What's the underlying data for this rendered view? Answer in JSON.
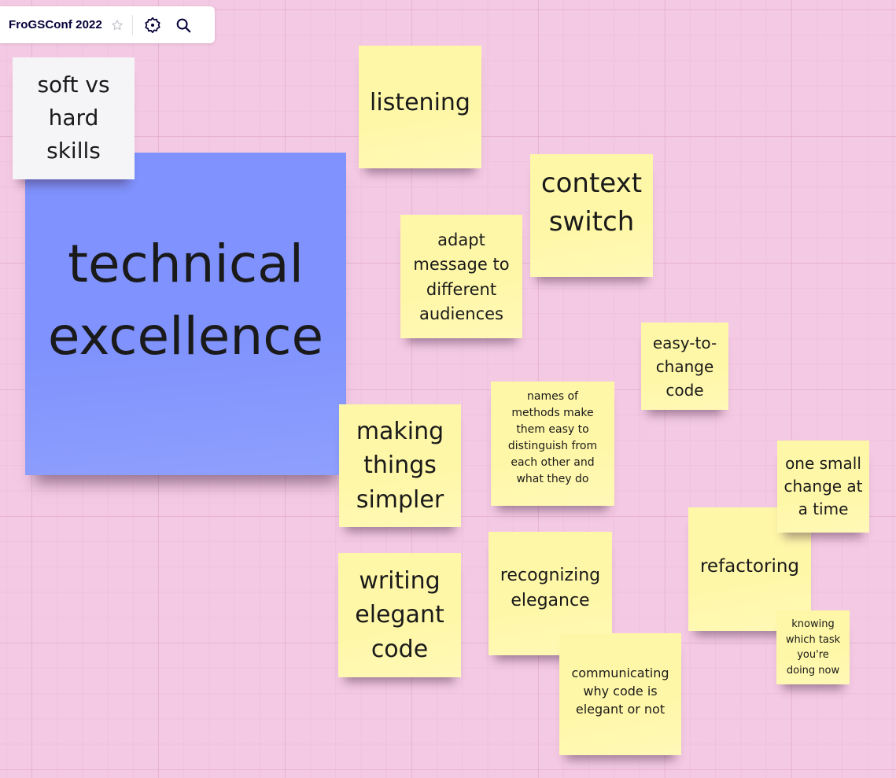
{
  "board": {
    "title": "FroGSConf 2022",
    "icons": [
      "star-icon",
      "settings-gear-icon",
      "search-icon"
    ]
  },
  "colors": {
    "background": "#f4c9e3",
    "note_yellow": "#fff7a8",
    "note_blue": "#7f92fd",
    "note_white": "#f5f5f8"
  },
  "notes": [
    {
      "id": "soft-vs-hard-skills",
      "text": "soft vs\nhard\nskills",
      "color": "white"
    },
    {
      "id": "technical-excellence",
      "text": "technical\nexcellence",
      "color": "blue"
    },
    {
      "id": "listening",
      "text": "listening",
      "color": "yellow"
    },
    {
      "id": "context-switch",
      "text": "context\nswitch",
      "color": "yellow"
    },
    {
      "id": "adapt-message",
      "text": "adapt\nmessage to\ndifferent\naudiences",
      "color": "yellow"
    },
    {
      "id": "easy-to-change-code",
      "text": "easy-to-\nchange\ncode",
      "color": "yellow"
    },
    {
      "id": "making-things-simpler",
      "text": "making\nthings\nsimpler",
      "color": "yellow"
    },
    {
      "id": "names-of-methods",
      "text": "names of\nmethods make\nthem easy to\ndistinguish from\neach other and\nwhat they do",
      "color": "yellow"
    },
    {
      "id": "one-small-change",
      "text": "one small\nchange at\na time",
      "color": "yellow"
    },
    {
      "id": "refactoring",
      "text": "refactoring",
      "color": "yellow"
    },
    {
      "id": "writing-elegant-code",
      "text": "writing\nelegant\ncode",
      "color": "yellow"
    },
    {
      "id": "recognizing-elegance",
      "text": "recognizing\nelegance",
      "color": "yellow"
    },
    {
      "id": "communicating-why",
      "text": "communicating\nwhy code is\nelegant or not",
      "color": "yellow"
    },
    {
      "id": "knowing-which-task",
      "text": "knowing\nwhich task\nyou're\ndoing now",
      "color": "yellow"
    }
  ]
}
